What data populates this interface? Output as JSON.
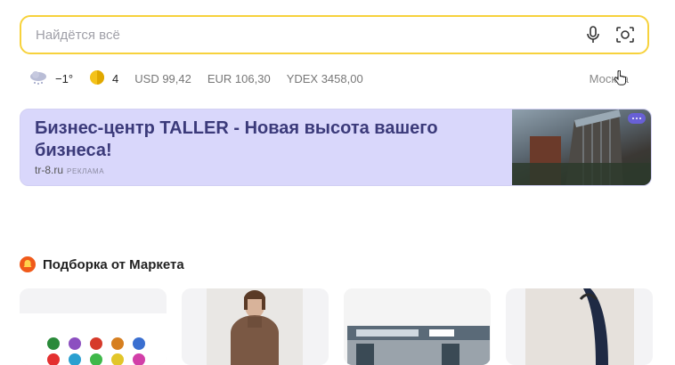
{
  "search": {
    "placeholder": "Найдётся всё",
    "mic_icon": "microphone-icon",
    "camera_icon": "camera-search-icon"
  },
  "infobar": {
    "weather_icon": "cloud-snow-icon",
    "temperature": "−1°",
    "traffic_icon": "traffic-light-icon",
    "traffic_level": "4",
    "usd": "USD 99,42",
    "eur": "EUR 106,30",
    "ydex": "YDEX 3458,00",
    "city": "Москва"
  },
  "ad": {
    "title": "Бизнес-центр TALLER - Новая высота вашего бизнеса!",
    "domain": "tr-8.ru",
    "tag": "РЕКЛАМА",
    "colors": {
      "background": "#d9d7fb",
      "title": "#3b3a7a",
      "menu": "#6860d6"
    }
  },
  "section": {
    "title": "Подборка от Маркета",
    "icon": "market-bell-icon"
  },
  "cards": [
    {
      "image": "rubber-ducks-image"
    },
    {
      "image": "woman-sweater-image"
    },
    {
      "image": "toy-cafe-image"
    },
    {
      "image": "leather-bag-image"
    }
  ],
  "colors": {
    "search_border": "#f7d23c"
  }
}
